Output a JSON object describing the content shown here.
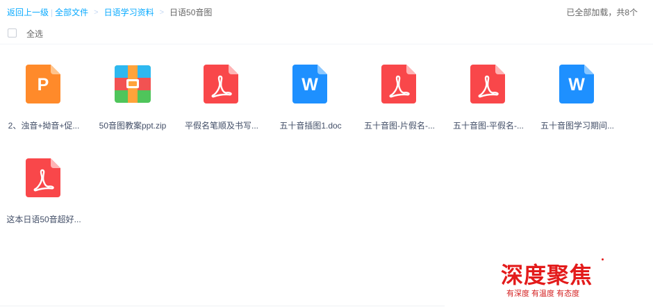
{
  "breadcrumb": {
    "back": "返回上一级",
    "sep_bar": "|",
    "all_files": "全部文件",
    "sep1": ">",
    "folder": "日语学习资料",
    "sep2": ">",
    "current": "日语50音图"
  },
  "status": {
    "loaded": "已全部加载，共8个"
  },
  "select_all": {
    "label": "全选"
  },
  "files": [
    {
      "name": "2、浊音+拗音+促...",
      "type": "ppt",
      "icon": "ppt-file-icon",
      "letter": "P",
      "color": "#ff8a2a"
    },
    {
      "name": "50音图教案ppt.zip",
      "type": "zip",
      "icon": "zip-file-icon"
    },
    {
      "name": "平假名笔顺及书写...",
      "type": "pdf",
      "icon": "pdf-file-icon",
      "color": "#f9474a"
    },
    {
      "name": "五十音插图1.doc",
      "type": "doc",
      "icon": "doc-file-icon",
      "letter": "W",
      "color": "#1e90ff"
    },
    {
      "name": "五十音图-片假名-...",
      "type": "pdf",
      "icon": "pdf-file-icon",
      "color": "#f9474a"
    },
    {
      "name": "五十音图-平假名-...",
      "type": "pdf",
      "icon": "pdf-file-icon",
      "color": "#f9474a"
    },
    {
      "name": "五十音图学习期间...",
      "type": "doc",
      "icon": "doc-file-icon",
      "letter": "W",
      "color": "#1e90ff"
    },
    {
      "name": "这本日语50音超好...",
      "type": "pdf",
      "icon": "pdf-file-icon",
      "color": "#f9474a"
    }
  ],
  "watermark": {
    "title": "深度聚焦",
    "subtitle": "有深度 有温度 有态度",
    "color": "#e31b1b"
  }
}
